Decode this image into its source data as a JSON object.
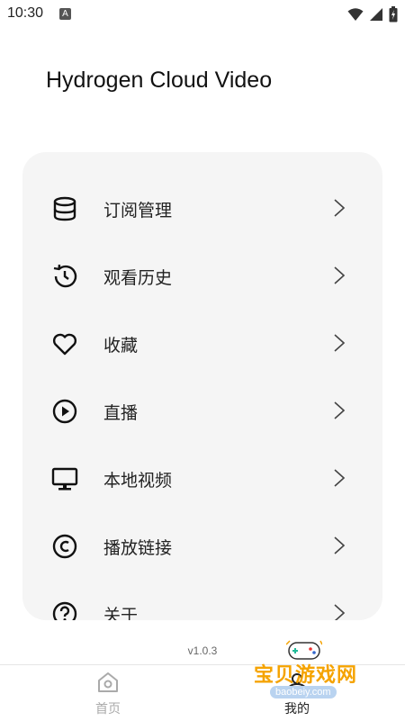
{
  "status_bar": {
    "time": "10:30",
    "notification_badge": "A"
  },
  "app": {
    "title": "Hydrogen Cloud Video",
    "version": "v1.0.3"
  },
  "menu": {
    "items": [
      {
        "label": "订阅管理",
        "icon": "database-icon"
      },
      {
        "label": "观看历史",
        "icon": "history-icon"
      },
      {
        "label": "收藏",
        "icon": "heart-icon"
      },
      {
        "label": "直播",
        "icon": "play-circle-icon"
      },
      {
        "label": "本地视频",
        "icon": "monitor-icon"
      },
      {
        "label": "播放链接",
        "icon": "copyright-icon"
      },
      {
        "label": "关于",
        "icon": "help-icon"
      }
    ]
  },
  "bottom_nav": {
    "home_label": "首页",
    "mine_label": "我的"
  },
  "watermark": {
    "text": "宝贝游戏网",
    "url": "baobeiy.com"
  },
  "colors": {
    "card_bg": "#f5f5f5",
    "watermark_orange": "#f5a300"
  }
}
